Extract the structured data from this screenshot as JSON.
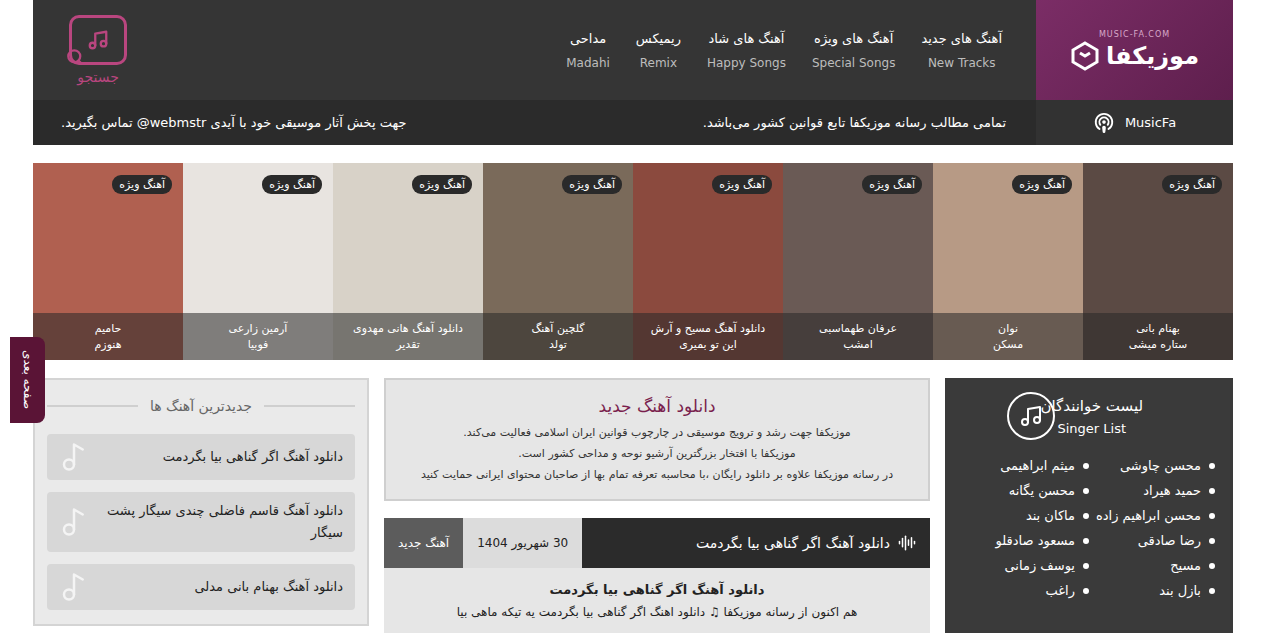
{
  "header": {
    "logo": {
      "name": "موزیکفا",
      "domain": "MUSIC-FA.COM"
    },
    "nav": [
      {
        "label": "آهنگ های جدید",
        "sub": "New Tracks"
      },
      {
        "label": "آهنگ های ویژه",
        "sub": "Special Songs"
      },
      {
        "label": "آهنگ های شاد",
        "sub": "Happy Songs"
      },
      {
        "label": "ریمیکس",
        "sub": "Remix"
      },
      {
        "label": "مداحی",
        "sub": "Madahi"
      }
    ],
    "search": {
      "label": "جستجو"
    }
  },
  "notice_bar": {
    "brand": "MusicFa",
    "notice": "تمامی مطالب رسانه موزیکفا تابع قوانین کشور می‌باشد.",
    "contact": "جهت پخش آثار موسیقی خود با آیدی webmstr@ تماس بگیرید."
  },
  "slider": [
    {
      "badge": "آهنگ ویژه",
      "line1": "بهنام بانی",
      "line2": "ستاره میشی"
    },
    {
      "badge": "آهنگ ویژه",
      "line1": "نوان",
      "line2": "مسکن"
    },
    {
      "badge": "آهنگ ویژه",
      "line1": "عرفان طهماسبی",
      "line2": "امشب"
    },
    {
      "badge": "آهنگ ویژه",
      "line1": "دانلود آهنگ مسیح و آرش",
      "line2": "این تو بمیری"
    },
    {
      "badge": "آهنگ ویژه",
      "line1": "گلچین آهنگ",
      "line2": "تولد"
    },
    {
      "badge": "آهنگ ویژه",
      "line1": "دانلود آهنگ هانی مهدوی",
      "line2": "تقدیر"
    },
    {
      "badge": "آهنگ ویژه",
      "line1": "آرمین زارعی",
      "line2": "فوبیا"
    },
    {
      "badge": "آهنگ ویژه",
      "line1": "حامیم",
      "line2": "هنوزم"
    }
  ],
  "next_tab": "صفحه بعدی",
  "latest": {
    "title": "جدیدترین آهنگ ها",
    "items": [
      "دانلود آهنگ اگر گناهی بیا بگردمت",
      "دانلود آهنگ قاسم فاضلی چندی سیگار پشت سیگار",
      "دانلود آهنگ بهنام بانی مدلی"
    ]
  },
  "intro": {
    "title": "دانلود آهنگ جدید",
    "lines": [
      "موزیکفا جهت رشد و ترویج موسیقی در چارچوب قوانین ایران اسلامی فعالیت می‌کند.",
      "موزیکفا با افتخار بزرگترین آرشیو نوحه و مداحی کشور است.",
      "در رسانه موزیکفا علاوه بر دانلود رایگان ،با محاسبه تعرفه تمام بها از صاحبان محتوای ایرانی حمایت کنید"
    ]
  },
  "post": {
    "title": "دانلود آهنگ اگر گناهی بیا بگردمت",
    "date": "30 شهریور 1404",
    "category": "آهنگ جدید",
    "heading": "دانلود آهنگ اگر گناهی بیا بگردمت",
    "excerpt": "هم اکنون از رسانه موزیکفا ♫ دانلود اهنگ اگر گناهی بیا بگردمت یه تیکه ماهی بیا"
  },
  "singers": {
    "title": "لیست خوانندگان",
    "subtitle": "Singer List",
    "items": [
      "محسن چاوشی",
      "میثم ابراهیمی",
      "حمید هیراد",
      "محسن یگانه",
      "محسن ابراهیم زاده",
      "ماکان بند",
      "رضا صادقی",
      "مسعود صادقلو",
      "مسیح",
      "یوسف زمانی",
      "بازل بند",
      "راغب"
    ]
  }
}
